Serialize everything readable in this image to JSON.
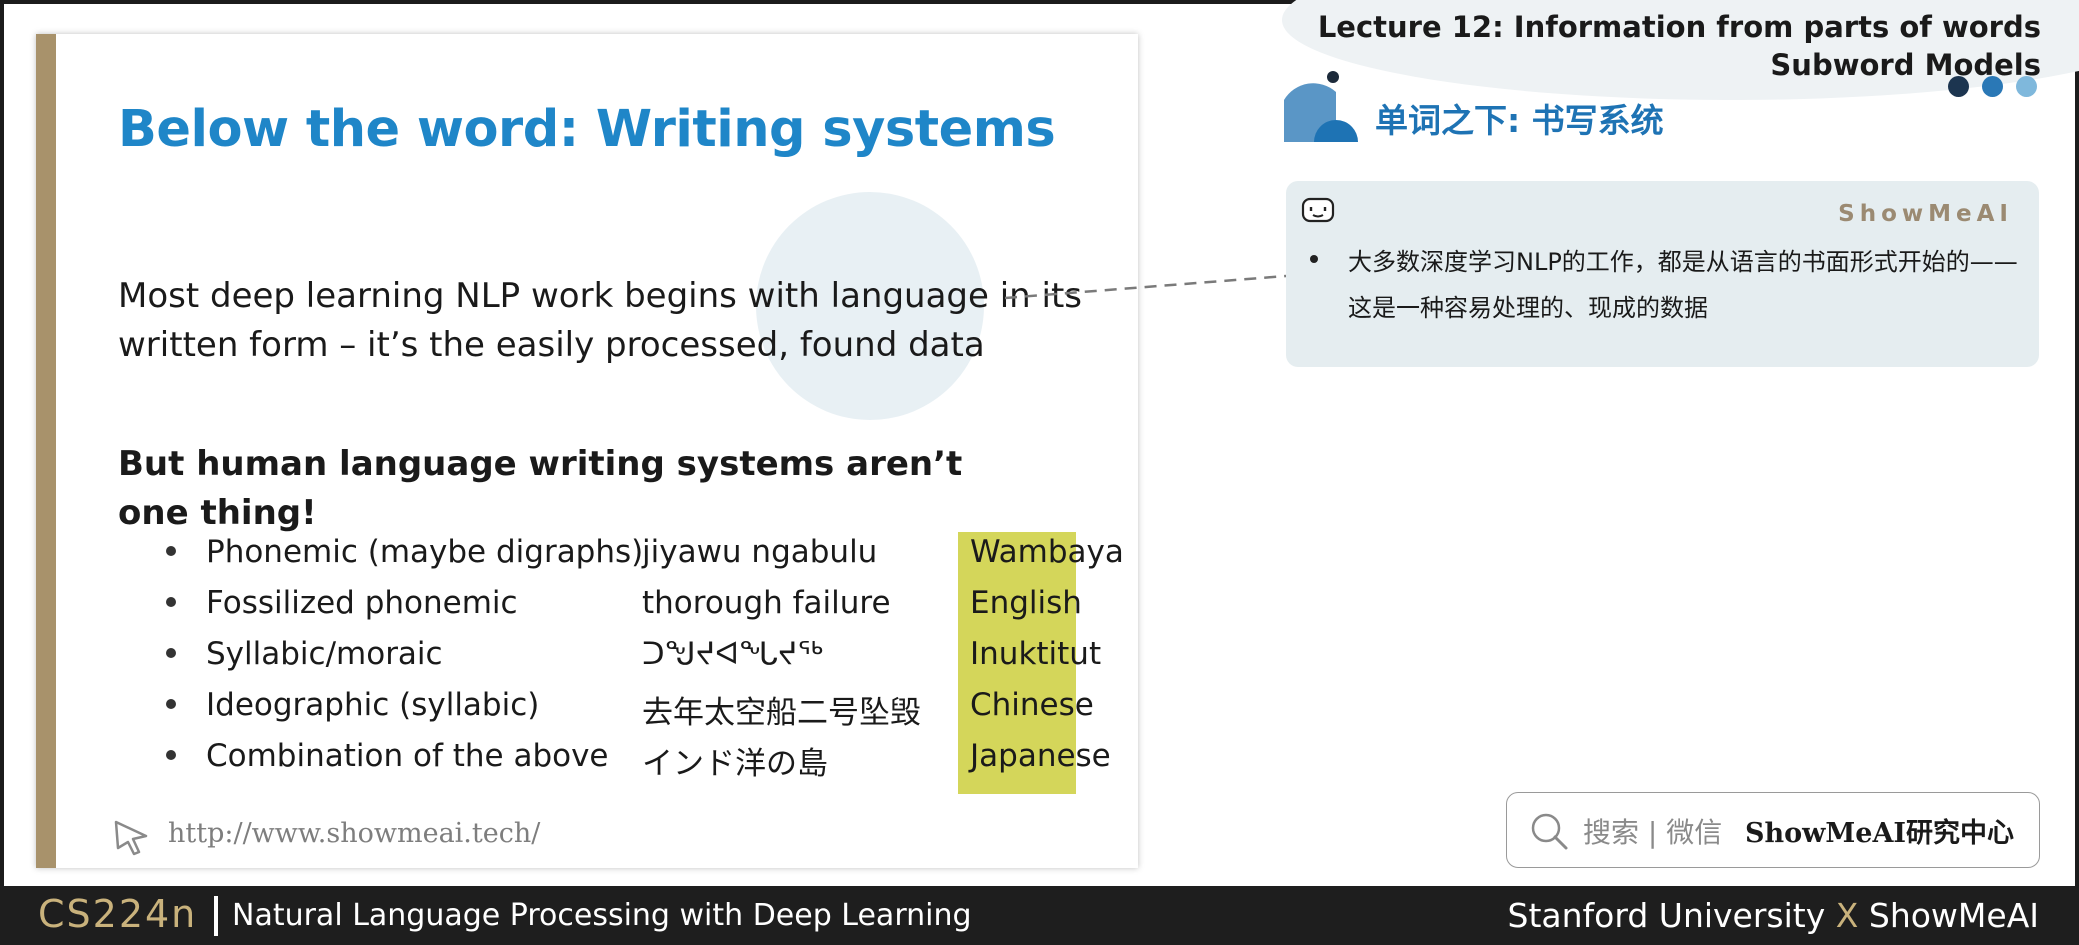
{
  "slide": {
    "title": "Below the word: Writing systems",
    "intro": "Most deep learning NLP work begins with language in its written form – it’s the easily processed, found data",
    "emphasis": "But human language writing systems aren’t one thing!",
    "rows": [
      {
        "type": "Phonemic (maybe digraphs)",
        "example": "jiyawu ngabulu",
        "language": "Wambaya"
      },
      {
        "type": "Fossilized phonemic",
        "example": "thorough failure",
        "language": "English"
      },
      {
        "type": "Syllabic/moraic",
        "example": "ᑐᖑᔪᐊᖓᔪᖅ",
        "language": "Inuktitut"
      },
      {
        "type": "Ideographic  (syllabic)",
        "example": "去年太空船二号坠毁",
        "language": "Chinese"
      },
      {
        "type": "Combination of the above",
        "example": "インド洋の島",
        "language": "Japanese"
      }
    ],
    "url": "http://www.showmeai.tech/",
    "colors": {
      "title": "#1f86c8",
      "language_highlight": "#d4d65a",
      "side_bar": "#a8926b"
    }
  },
  "header": {
    "lecture_line1": "Lecture 12: Information from parts of words",
    "lecture_line2": "Subword Models"
  },
  "section": {
    "title": "单词之下: 书写系统"
  },
  "note": {
    "brand": "ShowMeAI",
    "text": "大多数深度学习NLP的工作，都是从语言的书面形式开始的——这是一种容易处理的、现成的数据"
  },
  "search": {
    "placeholder": "搜索 | 微信",
    "brand": "ShowMeAI研究中心"
  },
  "footer": {
    "course_code": "CS224n",
    "course_name": "Natural Language Processing with Deep Learning",
    "university": "Stanford University",
    "x": "X",
    "partner": "ShowMeAI"
  },
  "icons": [
    "cursor-icon",
    "robot-icon",
    "search-icon",
    "section-icon"
  ]
}
